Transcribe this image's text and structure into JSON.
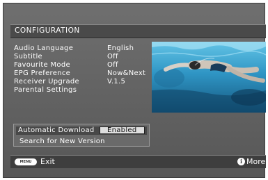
{
  "screen": {
    "title": "CONFIGURATION"
  },
  "settings": [
    {
      "label": "Audio Language",
      "value": "English"
    },
    {
      "label": "Subtitle",
      "value": "Off"
    },
    {
      "label": "Favourite Mode",
      "value": "Off"
    },
    {
      "label": "EPG Preference",
      "value": "Now&Next"
    },
    {
      "label": "Receiver Upgrade",
      "value": "V.1.5"
    },
    {
      "label": "Parental Settings",
      "value": ""
    }
  ],
  "software": {
    "automatic_download_label": "Automatic Download",
    "automatic_download_value": "Enabled",
    "search_label": "Search for New Version"
  },
  "footer": {
    "menu_button_text": "MENU",
    "exit_label": "Exit",
    "info_icon_text": "i",
    "more_label": "More"
  },
  "colors": {
    "panel": "#666666",
    "title_bar": "#4a4a4a",
    "footer": "#3e3e3e",
    "selected_value": "#dedede"
  },
  "preview": {
    "content": "swimmer-underwater-image"
  }
}
